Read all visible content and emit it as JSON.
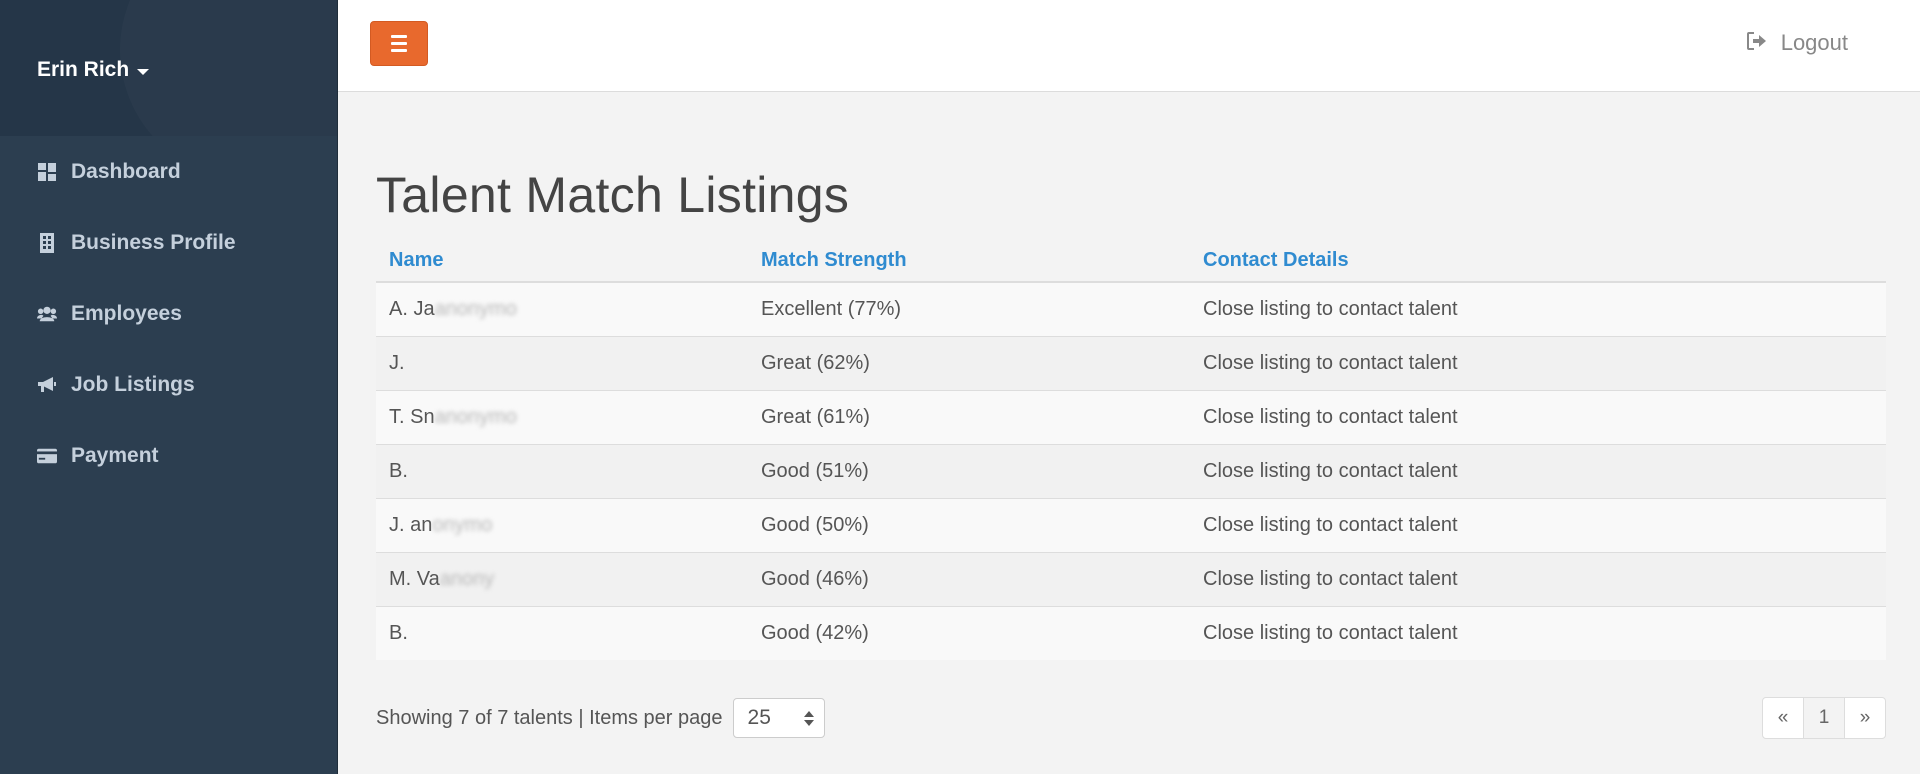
{
  "sidebar": {
    "user_name": "Erin Rich",
    "items": [
      {
        "label": "Dashboard",
        "icon": "dashboard-icon"
      },
      {
        "label": "Business Profile",
        "icon": "building-icon"
      },
      {
        "label": "Employees",
        "icon": "users-icon"
      },
      {
        "label": "Job Listings",
        "icon": "megaphone-icon"
      },
      {
        "label": "Payment",
        "icon": "credit-card-icon"
      }
    ]
  },
  "topbar": {
    "menu_icon": "hamburger-icon",
    "logout_label": "Logout",
    "logout_icon": "sign-out-icon"
  },
  "page": {
    "title": "Talent Match Listings"
  },
  "table": {
    "columns": [
      "Name",
      "Match Strength",
      "Contact Details"
    ],
    "rows": [
      {
        "name": "A. Ja",
        "name_hidden": "anonymo",
        "match": "Excellent (77%)",
        "contact": "Close listing to contact talent"
      },
      {
        "name": "J.",
        "name_hidden": "",
        "match": "Great (62%)",
        "contact": "Close listing to contact talent"
      },
      {
        "name": "T. Sn",
        "name_hidden": "anonymo",
        "match": "Great (61%)",
        "contact": "Close listing to contact talent"
      },
      {
        "name": "B.",
        "name_hidden": "",
        "match": "Good (51%)",
        "contact": "Close listing to contact talent"
      },
      {
        "name": "J. an",
        "name_hidden": "onymo",
        "match": "Good (50%)",
        "contact": "Close listing to contact talent"
      },
      {
        "name": "M. Va",
        "name_hidden": "anony",
        "match": "Good (46%)",
        "contact": "Close listing to contact talent"
      },
      {
        "name": "B.",
        "name_hidden": "",
        "match": "Good (42%)",
        "contact": "Close listing to contact talent"
      }
    ]
  },
  "footer": {
    "showing_text": "Showing 7 of 7 talents | Items per page",
    "per_page_value": "25",
    "pagination": {
      "prev": "«",
      "current": "1",
      "next": "»"
    }
  },
  "colors": {
    "sidebar_bg": "#2c3e50",
    "accent_orange": "#e8692d",
    "link_blue": "#2f8bd0"
  }
}
